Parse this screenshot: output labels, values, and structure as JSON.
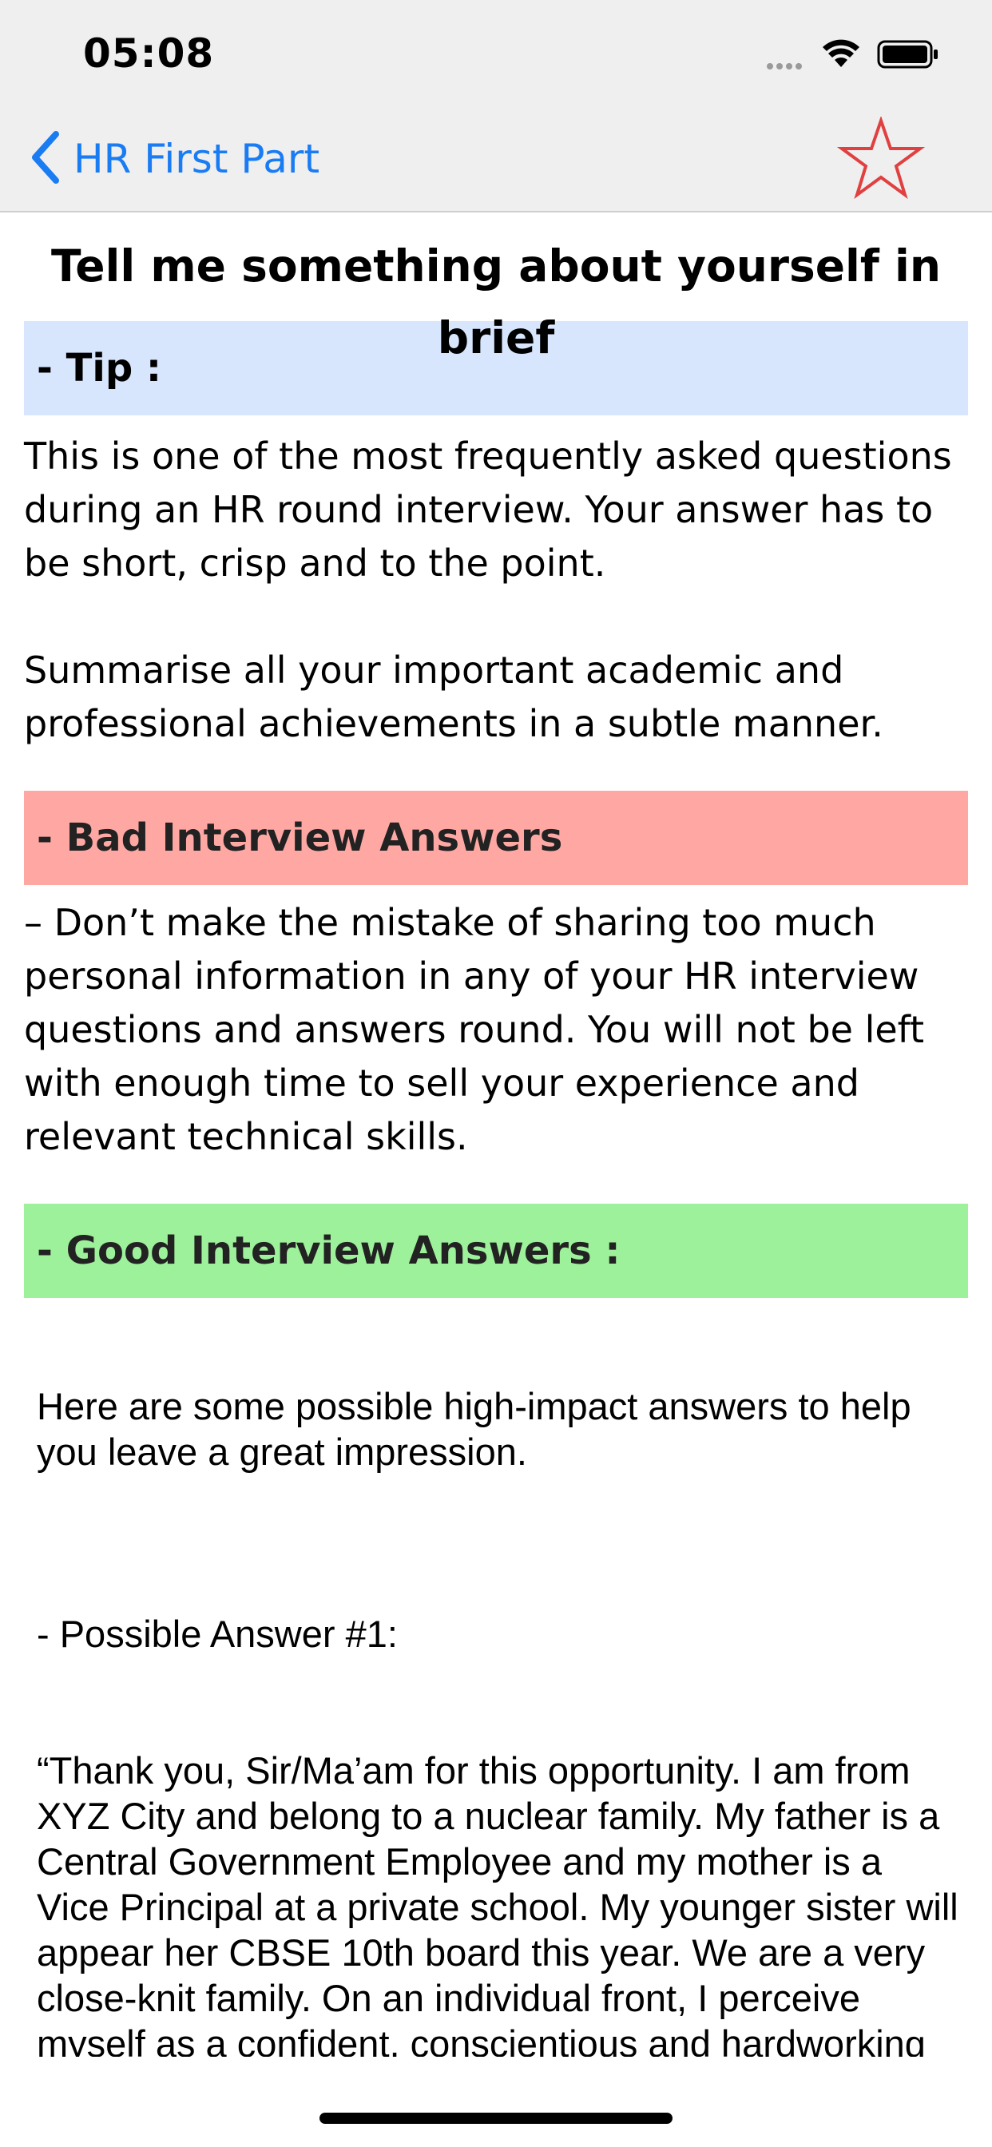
{
  "status_bar": {
    "time": "05:08"
  },
  "nav": {
    "back_label": "HR First Part",
    "back_icon": "chevron-left-icon",
    "favorite_icon": "star-outline-icon",
    "accent_color": "#1a7cf3",
    "star_color": "#e04040"
  },
  "question": {
    "title": "Tell me something about yourself in brief"
  },
  "tip": {
    "header": "- Tip :",
    "color": "#d7e5fd",
    "paragraphs": [
      "This is one of the most frequently asked questions during an HR round interview. Your answer has to be short, crisp and to the point.",
      "Summarise all your important academic and professional achievements in a subtle manner."
    ]
  },
  "bad": {
    "header": "- Bad Interview Answers",
    "color": "#ffa8a3",
    "text": "– Don’t make the mistake of sharing too much personal information in any of your HR interview questions and answers round. You will not be left with enough time to sell your experience and relevant technical skills."
  },
  "good": {
    "header": "- Good Interview Answers :",
    "color": "#9ef19b",
    "intro": "Here are some possible high-impact answers to help you leave a great impression.",
    "answer_label": "- Possible Answer #1:",
    "answer_text": "“Thank you, Sir/Ma’am for this opportunity. I am from XYZ City and belong to a nuclear family. My father is a Central Government Employee and my mother is a Vice Principal at a private school. My younger sister will appear her CBSE 10th board this year. We are a very close-knit family. On an individual front, I perceive myself as a confident, conscientious and hardworking individual. I carry out any task assigned to me without hesitation, provided the instructions are clear. In the case of doubt, I never hesitate to"
  }
}
